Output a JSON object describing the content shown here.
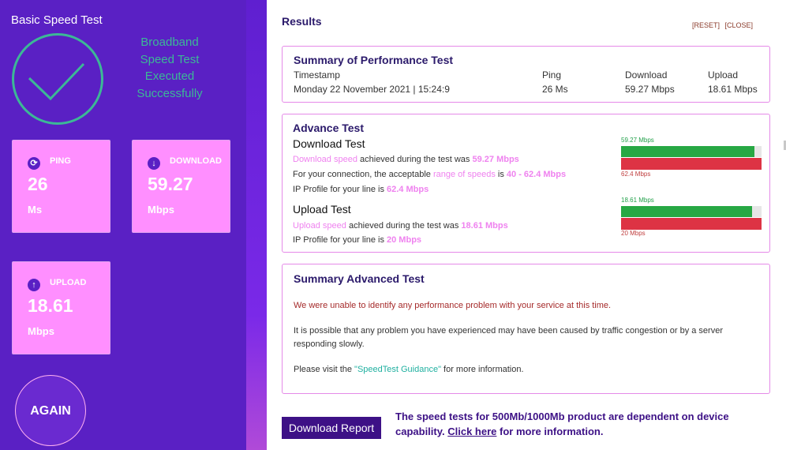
{
  "sidebar": {
    "title": "Basic Speed Test",
    "status_lines": [
      "Broadband",
      "Speed Test",
      "Executed",
      "Successfully"
    ],
    "cards": {
      "ping": {
        "label": "PING",
        "value": "26",
        "unit": "Ms"
      },
      "download": {
        "label": "DOWNLOAD",
        "value": "59.27",
        "unit": "Mbps"
      },
      "upload": {
        "label": "UPLOAD",
        "value": "18.61",
        "unit": "Mbps"
      }
    },
    "again_label": "AGAIN"
  },
  "results": {
    "title": "Results",
    "reset_label": "[RESET]",
    "close_label": "[CLOSE]"
  },
  "summary": {
    "heading": "Summary of Performance Test",
    "timestamp_label": "Timestamp",
    "timestamp_value": "Monday 22 November 2021 | 15:24:9",
    "ping_label": "Ping",
    "ping_value": "26 Ms",
    "download_label": "Download",
    "download_value": "59.27 Mbps",
    "upload_label": "Upload",
    "upload_value": "18.61 Mbps"
  },
  "advance": {
    "heading": "Advance Test",
    "download": {
      "heading": "Download Test",
      "l1_link": "Download speed",
      "l1_mid": " achieved during the test was ",
      "l1_value": "59.27 Mbps",
      "l2_pre": "For your connection, the acceptable ",
      "l2_link": "range of speeds",
      "l2_mid": " is ",
      "l2_value": "40 - 62.4 Mbps",
      "l3_pre": "IP Profile for your line is ",
      "l3_value": "62.4 Mbps",
      "bar_top_label": "59.27 Mbps",
      "bar_bottom_label": "62.4 Mbps",
      "bar_fill_fraction": 0.95
    },
    "upload": {
      "heading": "Upload Test",
      "l1_link": "Upload speed",
      "l1_mid": " achieved during the test was ",
      "l1_value": "18.61 Mbps",
      "l2_pre": "IP Profile for your line is ",
      "l2_value": "20 Mbps",
      "bar_top_label": "18.61 Mbps",
      "bar_bottom_label": "20 Mbps",
      "bar_fill_fraction": 0.93
    }
  },
  "advanced_summary": {
    "heading": "Summary Advanced Test",
    "p1": "We were unable to identify any performance problem with your service at this time.",
    "p2": "It is possible that any problem you have experienced may have been caused by traffic congestion or by a server responding slowly.",
    "p3_pre": "Please visit the ",
    "p3_link": "\"SpeedTest Guidance\"",
    "p3_post": " for more information."
  },
  "footer": {
    "report_button": "Download Report",
    "note_pre": "The speed tests for 500Mb/1000Mb product are dependent on device capability. ",
    "note_link": "Click here",
    "note_post": " for more information."
  },
  "colors": {
    "sidebar_bg": "#5a20c4",
    "card_bg": "#ff8fff",
    "status_teal": "#3cb896",
    "heading_navy": "#2b1a6b",
    "pink_highlight": "#ef82ef",
    "bar_green": "#27a844",
    "bar_red": "#dd3344"
  }
}
